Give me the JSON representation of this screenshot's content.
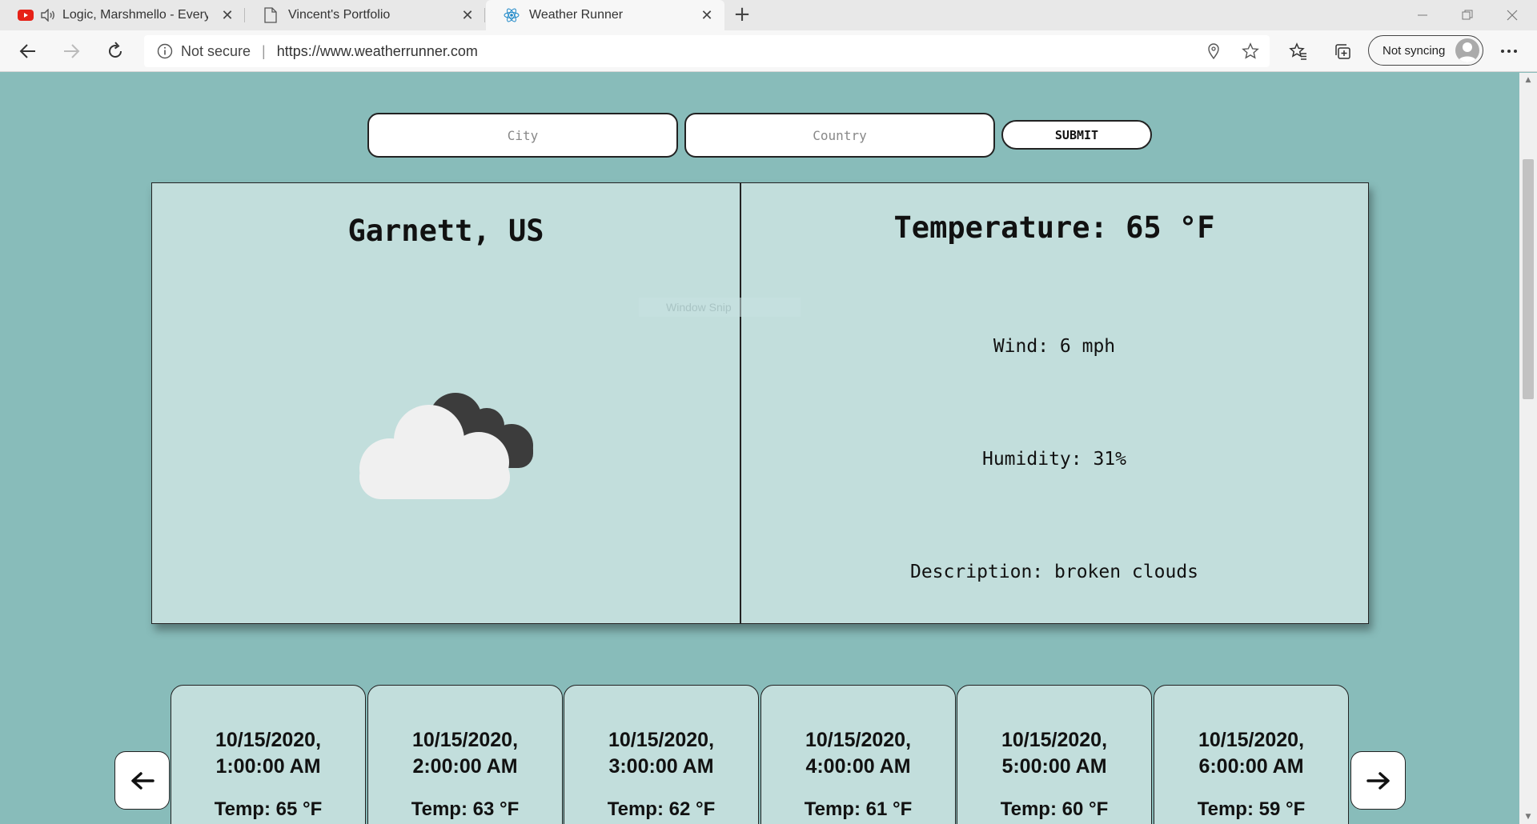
{
  "browser": {
    "tabs": [
      {
        "label": "Logic, Marshmello - Everyday",
        "icon": "youtube-icon"
      },
      {
        "label": "Vincent's Portfolio",
        "icon": "page-icon"
      },
      {
        "label": "Weather Runner",
        "icon": "react-icon"
      }
    ],
    "security": "Not secure",
    "url": "https://www.weatherrunner.com",
    "sync_label": "Not syncing"
  },
  "search": {
    "city_placeholder": "City",
    "country_placeholder": "Country",
    "submit_label": "SUBMIT"
  },
  "current": {
    "location": "Garnett, US",
    "temperature": "Temperature: 65 °F",
    "wind": "Wind: 6 mph",
    "humidity": "Humidity: 31%",
    "description": "Description: broken clouds",
    "icon": "broken-clouds-icon"
  },
  "overlay": {
    "snip_label": "Window Snip"
  },
  "forecast": [
    {
      "date": "10/15/2020,",
      "time": "1:00:00 AM",
      "temp": "Temp: 65 °F"
    },
    {
      "date": "10/15/2020,",
      "time": "2:00:00 AM",
      "temp": "Temp: 63 °F"
    },
    {
      "date": "10/15/2020,",
      "time": "3:00:00 AM",
      "temp": "Temp: 62 °F"
    },
    {
      "date": "10/15/2020,",
      "time": "4:00:00 AM",
      "temp": "Temp: 61 °F"
    },
    {
      "date": "10/15/2020,",
      "time": "5:00:00 AM",
      "temp": "Temp: 60 °F"
    },
    {
      "date": "10/15/2020,",
      "time": "6:00:00 AM",
      "temp": "Temp: 59 °F"
    }
  ],
  "colors": {
    "page_bg": "#88bcba",
    "card_bg": "#c2dedc"
  }
}
